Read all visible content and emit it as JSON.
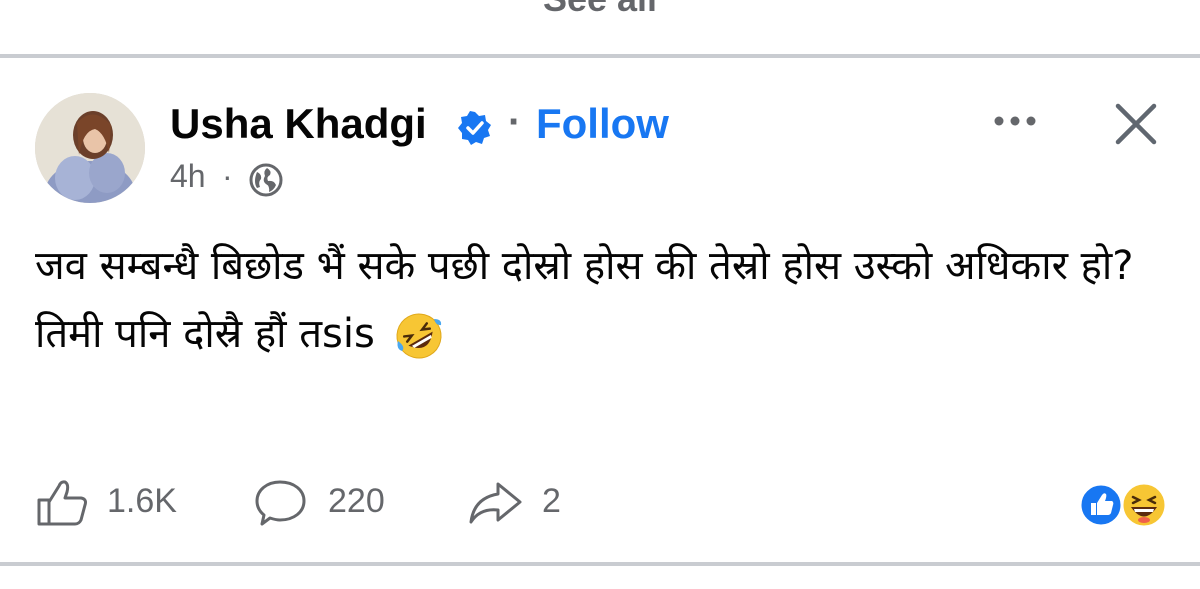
{
  "see_all": "See all",
  "author": {
    "name": "Usha Khadgi",
    "verified": true,
    "separator": "·",
    "follow_label": "Follow"
  },
  "meta": {
    "time": "4h",
    "separator": "·",
    "audience_icon": "globe-icon"
  },
  "post": {
    "text_line1": "जव सम्बन्धै बिछोड भैं सके पछी दोस्रो होस की तेस्रो होस उस्को अधिकार हो?",
    "text_line2": "तिमी पनि दोस्रै हौं तsis",
    "emoji": "rolling-on-floor-laughing"
  },
  "actions": {
    "like_count": "1.6K",
    "comment_count": "220",
    "share_count": "2"
  },
  "reactions": [
    "like-reaction-icon",
    "haha-reaction-icon"
  ],
  "colors": {
    "accent": "#1877f2",
    "secondary_text": "#65676b",
    "divider": "#c9ccd1"
  }
}
